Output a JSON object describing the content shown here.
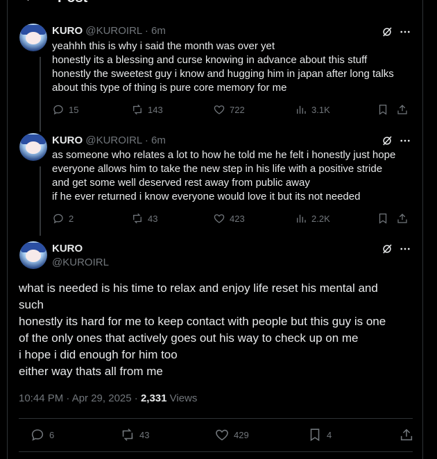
{
  "header": {
    "title": "Post"
  },
  "replies": [
    {
      "name": "KURO",
      "handle": "@KUROIRL",
      "time": "· 6m",
      "lines": [
        "yeahhh this is why i said the month was over yet",
        "honestly its a blessing and curse knowing in advance about this stuff",
        "honestly the sweetest guy i know and hugging him in japan after long talks",
        "about this type of thing is pure core memory for me"
      ],
      "replies": "15",
      "reposts": "143",
      "likes": "722",
      "views": "3.1K"
    },
    {
      "name": "KURO",
      "handle": "@KUROIRL",
      "time": "· 6m",
      "lines": [
        "as someone who relates a lot to how he told me he felt i honestly just hope",
        "everyone allows him to take the new step in his life with a positive stride",
        "and get some well deserved rest away from public away",
        "if he ever returned i know everyone would love it but its not needed"
      ],
      "replies": "2",
      "reposts": "43",
      "likes": "423",
      "views": "2.2K"
    }
  ],
  "main": {
    "name": "KURO",
    "handle": "@KUROIRL",
    "lines": [
      "what is needed is his time to relax and enjoy life reset his mental and",
      "such",
      "honestly its hard for me to keep contact with people but this guy is one",
      "of the only ones that actively goes out his way to check up on me",
      "i hope i did enough for him too",
      "either way thats all from me"
    ],
    "timestamp": "10:44 PM · Apr 29, 2025 · ",
    "views_count": "2,331",
    "views_label": " Views",
    "replies": "6",
    "reposts": "43",
    "likes": "429",
    "bookmarks": "4"
  }
}
